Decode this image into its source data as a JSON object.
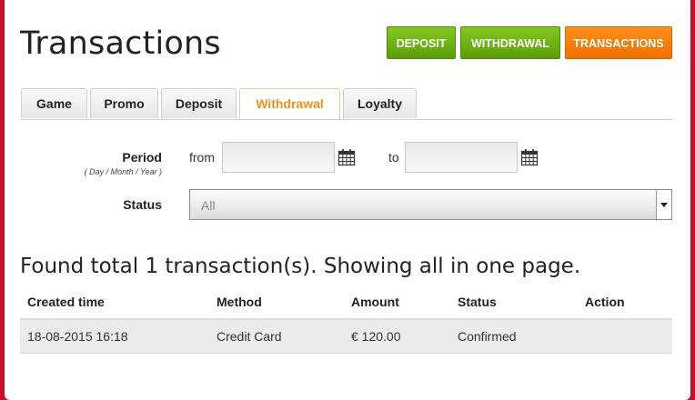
{
  "page": {
    "title": "Transactions"
  },
  "actions": {
    "deposit": "DEPOSIT",
    "withdrawal": "WITHDRAWAL",
    "transactions": "TRANSACTIONS"
  },
  "tabs": [
    {
      "label": "Game"
    },
    {
      "label": "Promo"
    },
    {
      "label": "Deposit"
    },
    {
      "label": "Withdrawal",
      "active": true
    },
    {
      "label": "Loyalty"
    }
  ],
  "filters": {
    "period_label": "Period",
    "period_hint": "( Day / Month / Year )",
    "from_label": "from",
    "to_label": "to",
    "from_value": "",
    "to_value": "",
    "status_label": "Status",
    "status_value": "All"
  },
  "results": {
    "summary": "Found total 1 transaction(s). Showing all in one page."
  },
  "table": {
    "headers": [
      "Created time",
      "Method",
      "Amount",
      "Status",
      "Action"
    ],
    "rows": [
      [
        "18-08-2015 16:18",
        "Credit Card",
        "€ 120.00",
        "Confirmed",
        ""
      ]
    ]
  },
  "colors": {
    "primary_green": "#6bb313",
    "accent_orange": "#f47b00",
    "background_red": "#c8102e"
  },
  "icons": {
    "calendar": "calendar-icon",
    "dropdown": "chevron-down-icon"
  }
}
